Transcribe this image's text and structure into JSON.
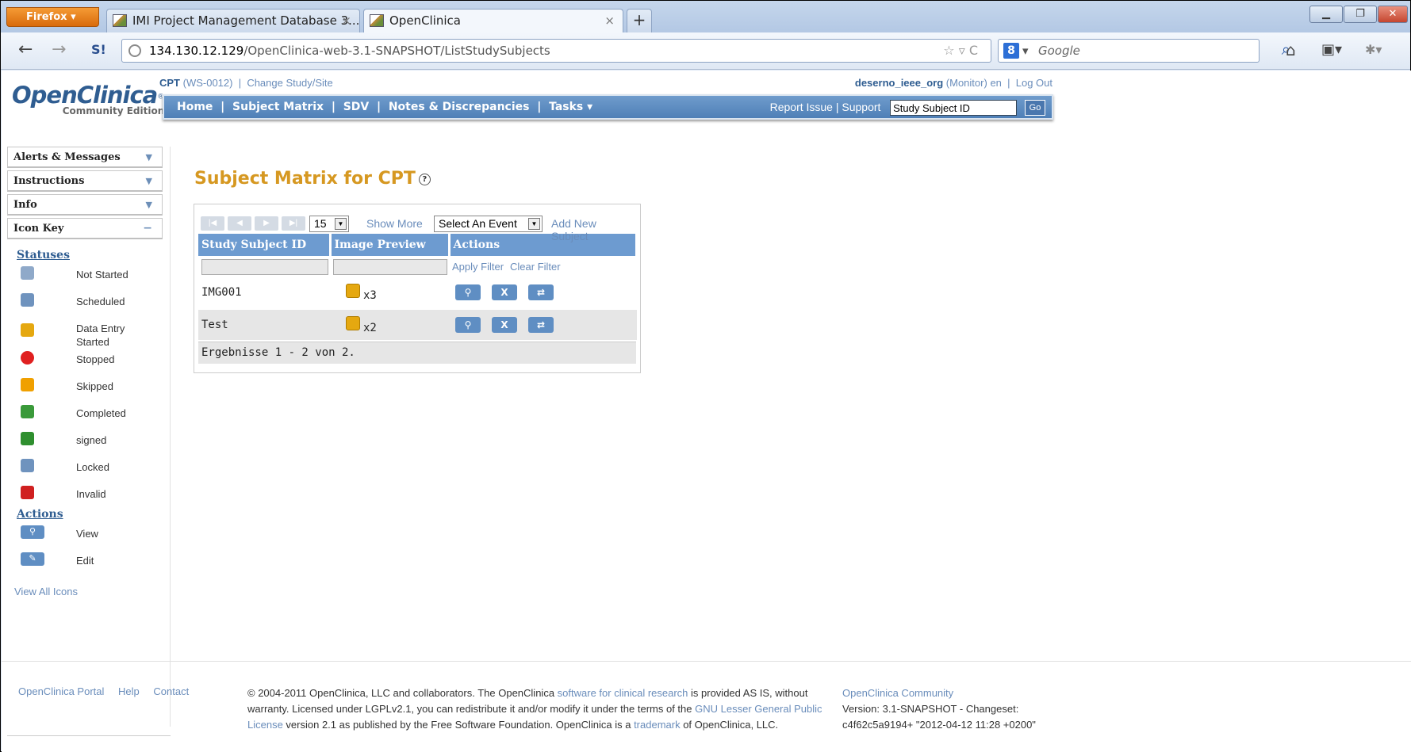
{
  "browser": {
    "app_button": "Firefox",
    "tabs": [
      {
        "label": "IMI Project Management Database 3....",
        "active": false
      },
      {
        "label": "OpenClinica",
        "active": true
      }
    ],
    "url_host": "134.130.12.129",
    "url_path": "/OpenClinica-web-3.1-SNAPSHOT/ListStudySubjects",
    "search_placeholder": "Google",
    "search_engine_icon": "8"
  },
  "app": {
    "logo_text": "OpenClinica",
    "logo_subtitle": "Community Edition",
    "study_name": "CPT",
    "study_code": "(WS-0012)",
    "change_study": "Change Study/Site",
    "username": "deserno_ieee_org",
    "role": "(Monitor)",
    "lang": "en",
    "logout": "Log Out",
    "nav": [
      "Home",
      "Subject Matrix",
      "SDV",
      "Notes & Discrepancies",
      "Tasks"
    ],
    "report_issue": "Report Issue",
    "support": "Support",
    "search_value": "Study Subject ID",
    "go_label": "Go"
  },
  "sidebar": {
    "panels": [
      {
        "label": "Alerts & Messages",
        "state": "collapsed"
      },
      {
        "label": "Instructions",
        "state": "collapsed"
      },
      {
        "label": "Info",
        "state": "collapsed"
      },
      {
        "label": "Icon Key",
        "state": "expanded"
      }
    ],
    "statuses_title": "Statuses",
    "statuses": [
      {
        "label": "Not Started",
        "color": "#8fa9c9",
        "icon": "blank-page-icon"
      },
      {
        "label": "Scheduled",
        "color": "#6f93be",
        "icon": "clock-page-icon"
      },
      {
        "label": "Data Entry Started",
        "color": "#e5a810",
        "icon": "pencil-page-icon"
      },
      {
        "label": "Stopped",
        "color": "#e02020",
        "icon": "stop-icon"
      },
      {
        "label": "Skipped",
        "color": "#f0a000",
        "icon": "skip-page-icon"
      },
      {
        "label": "Completed",
        "color": "#3a9a3a",
        "icon": "check-page-icon"
      },
      {
        "label": "signed",
        "color": "#2f8f2f",
        "icon": "signed-person-icon"
      },
      {
        "label": "Locked",
        "color": "#6f93be",
        "icon": "lock-page-icon"
      },
      {
        "label": "Invalid",
        "color": "#d02020",
        "icon": "invalid-x-icon"
      }
    ],
    "actions_title": "Actions",
    "actions": [
      {
        "label": "View",
        "color": "#5f8ec3",
        "icon": "magnifier-icon"
      },
      {
        "label": "Edit",
        "color": "#5f8ec3",
        "icon": "pencil-icon"
      }
    ],
    "view_all": "View All Icons"
  },
  "main": {
    "title": "Subject Matrix for CPT",
    "page_size": "15",
    "show_more": "Show More",
    "event_select": "Select An Event",
    "add_subject": "Add New Subject",
    "columns": [
      "Study Subject ID",
      "Image Preview",
      "Actions"
    ],
    "apply_filter": "Apply Filter",
    "clear_filter": "Clear Filter",
    "rows": [
      {
        "id": "IMG001",
        "preview_count": "x3"
      },
      {
        "id": "Test",
        "preview_count": "x2"
      }
    ],
    "results": "Ergebnisse 1 - 2 von 2."
  },
  "footer": {
    "links": [
      "OpenClinica Portal",
      "Help",
      "Contact"
    ],
    "copy_1": "© 2004-2011 OpenClinica, LLC and collaborators. The OpenClinica ",
    "copy_link1": "software for clinical research",
    "copy_2": " is provided AS IS, without warranty. Licensed under LGPLv2.1, you can redistribute it and/or modify it under the terms of the ",
    "copy_link2": "GNU Lesser General Public License",
    "copy_3": " version 2.1 as published by the Free Software Foundation. OpenClinica is a ",
    "copy_link3": "trademark",
    "copy_4": " of OpenClinica, LLC.",
    "community_title": "OpenClinica Community",
    "version": "Version: 3.1-SNAPSHOT - Changeset: c4f62c5a9194+ \"2012-04-12 11:28 +0200\""
  }
}
